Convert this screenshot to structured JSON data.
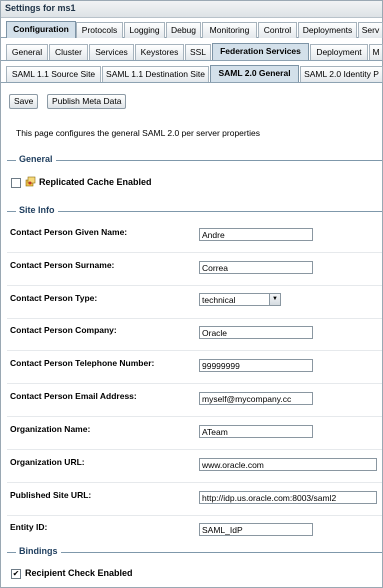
{
  "window": {
    "title": "Settings for ms1"
  },
  "tabs_level1": [
    "Configuration",
    "Protocols",
    "Logging",
    "Debug",
    "Monitoring",
    "Control",
    "Deployments",
    "Serv"
  ],
  "tabs_level2": [
    "General",
    "Cluster",
    "Services",
    "Keystores",
    "SSL",
    "Federation Services",
    "Deployment",
    "M"
  ],
  "tabs_level3": [
    "SAML 1.1 Source Site",
    "SAML 1.1 Destination Site",
    "SAML 2.0 General",
    "SAML 2.0 Identity P"
  ],
  "toolbar": {
    "save_label": "Save",
    "publish_label": "Publish Meta Data"
  },
  "description": "This page configures the general SAML 2.0 per server properties",
  "general": {
    "heading": "General",
    "replicated_cache_label": "Replicated Cache Enabled",
    "replicated_cache_checked": false
  },
  "site_info": {
    "heading": "Site Info",
    "fields": [
      {
        "label": "Contact Person Given Name:",
        "value": "Andre"
      },
      {
        "label": "Contact Person Surname:",
        "value": "Correa"
      },
      {
        "label": "Contact Person Type:",
        "value": "technical"
      },
      {
        "label": "Contact Person Company:",
        "value": "Oracle"
      },
      {
        "label": "Contact Person Telephone Number:",
        "value": "99999999"
      },
      {
        "label": "Contact Person Email Address:",
        "value": "myself@mycompany.cc"
      },
      {
        "label": "Organization Name:",
        "value": "ATeam"
      },
      {
        "label": "Organization URL:",
        "value": "www.oracle.com"
      },
      {
        "label": "Published Site URL:",
        "value": "http://idp.us.oracle.com:8003/saml2"
      },
      {
        "label": "Entity ID:",
        "value": "SAML_IdP"
      }
    ]
  },
  "bindings": {
    "heading": "Bindings",
    "recipient_check_label": "Recipient Check Enabled",
    "recipient_check_checked": true
  }
}
